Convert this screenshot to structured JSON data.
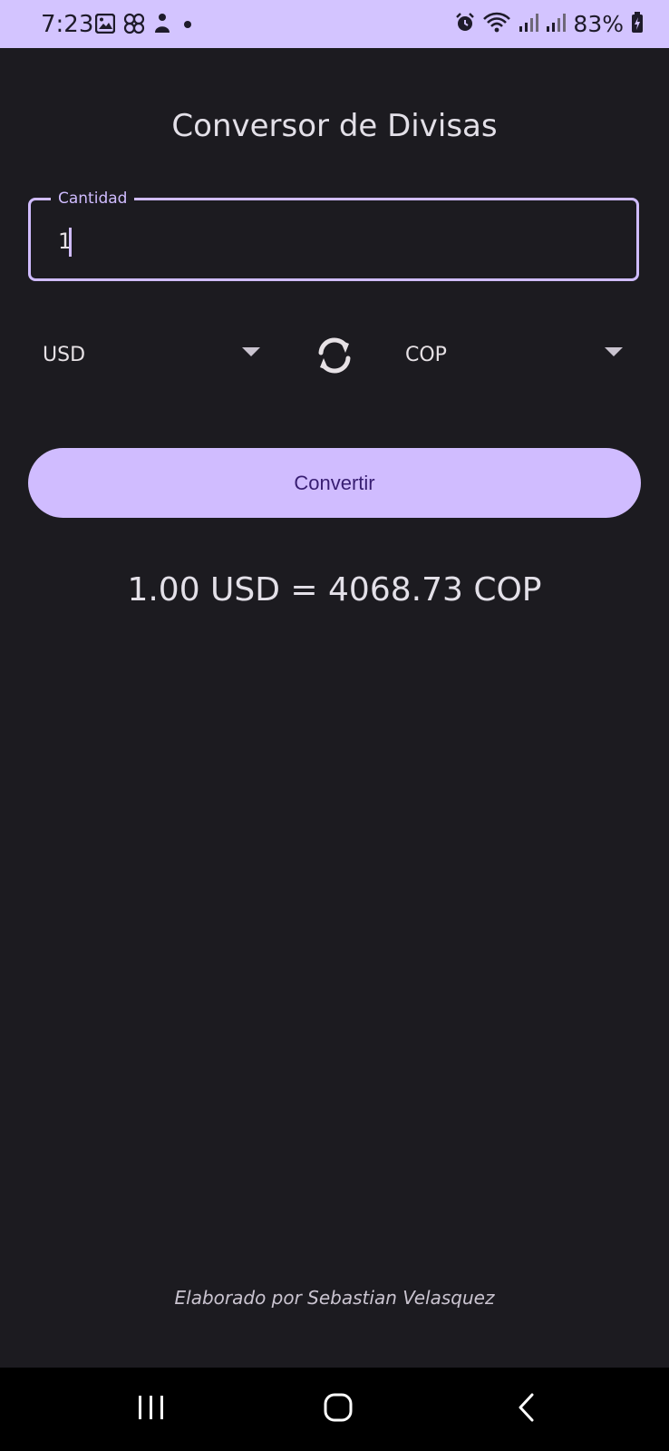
{
  "status_bar": {
    "time": "7:23",
    "battery": "83%",
    "background_color": "#d3c4ff",
    "left_icons": [
      "gallery-icon",
      "pinwheel-icon",
      "app-icon",
      "dot-icon"
    ],
    "right_icons": [
      "alarm-icon",
      "wifi-icon",
      "signal-icon",
      "signal-icon",
      "battery-charging-icon"
    ]
  },
  "app": {
    "title": "Conversor de Divisas",
    "accent_color": "#d0bcff",
    "background_color": "#1c1b20"
  },
  "amount_field": {
    "label": "Cantidad",
    "value": "1"
  },
  "from_currency": {
    "value": "USD"
  },
  "to_currency": {
    "value": "COP"
  },
  "swap_button": {
    "icon": "swap-icon"
  },
  "convert_button": {
    "label": "Convertir"
  },
  "result": {
    "text": "1.00 USD = 4068.73 COP"
  },
  "footer": {
    "text": "Elaborado por Sebastian Velasquez"
  },
  "nav_bar": {
    "icons": [
      "recent-apps-icon",
      "home-icon",
      "back-icon"
    ]
  }
}
